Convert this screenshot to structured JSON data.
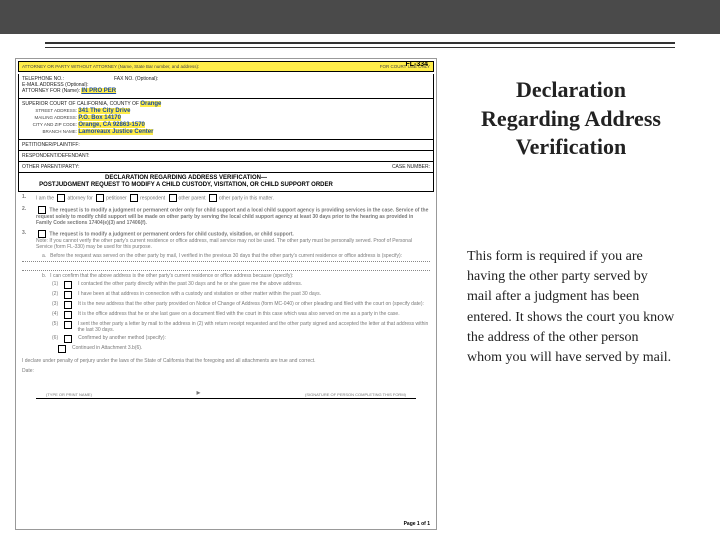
{
  "slide": {
    "title": "Declaration Regarding Address Verification",
    "description": "This form is required if you are having the other party served by mail after a judgment has been entered. It shows the court you know the address of the other person whom you will have served by mail."
  },
  "form": {
    "code": "FL-334",
    "attorney_header": "ATTORNEY OR PARTY WITHOUT ATTORNEY (Name, State Bar number, and address):",
    "court_use": "FOR COURT USE ONLY",
    "telephone": "TELEPHONE NO.:",
    "fax": "FAX NO. (Optional):",
    "email": "E-MAIL ADDRESS (Optional):",
    "atty_for": "ATTORNEY FOR (Name):",
    "in_pro_per": "IN PRO PER",
    "court_line": "SUPERIOR COURT OF CALIFORNIA, COUNTY OF",
    "county": "Orange",
    "street_lbl": "STREET ADDRESS:",
    "street": "341 The City Drive",
    "mail_lbl": "MAILING ADDRESS:",
    "mail": "P.O. Box 14170",
    "city_lbl": "CITY AND ZIP CODE:",
    "city": "Orange, CA 92863-1570",
    "branch_lbl": "BRANCH NAME:",
    "branch": "Lamoreaux Justice Center",
    "petitioner": "PETITIONER/PLAINTIFF:",
    "respondent": "RESPONDENT/DEFENDANT:",
    "other_party": "OTHER PARENT/PARTY:",
    "case_no": "CASE NUMBER:",
    "form_title_1": "DECLARATION REGARDING ADDRESS VERIFICATION—",
    "form_title_2": "POSTJUDGMENT REQUEST TO MODIFY A CHILD CUSTODY, VISITATION, OR CHILD SUPPORT ORDER",
    "item1": "I am the",
    "opt1": "attorney for",
    "opt2": "petitioner",
    "opt3": "respondent",
    "opt4": "other parent",
    "opt5": "other party",
    "item1_tail": "in this matter.",
    "item2": "The request is to modify a judgment or permanent order only for child support and a local child support agency is providing services in the case. Service of the request solely to modify child support will be made on other party by serving the local child support agency at least 30 days prior to the hearing as provided in Family Code sections 17404(e)(3) and 17406(f).",
    "item3": "The request is to modify a judgment or permanent orders for child custody, visitation, or child support.",
    "item3_note": "Note: If you cannot verify the other party's current residence or office address, mail service may not be used. The other party must be personally served. Proof of Personal Service (form FL-330) may be used for this purpose.",
    "item3a": "Before the request was served on the other party by mail, I verified in the previous 30 days that the other party's current residence or office address is (specify):",
    "item3b": "I can confirm that the above address is the other party's current residence or office address because (specify):",
    "sub1": "I contacted the other party directly within the past 30 days and he or she gave me the above address.",
    "sub2": "I have been at that address in connection with a custody and visitation or other matter within the past 30 days.",
    "sub3": "It is the new address that the other party provided on Notice of Change of Address (form MC-040) or other pleading and filed with the court on (specify date):",
    "sub4": "It is the office address that he or she last gave on a document filed with the court in this case which was also served on me as a party in the case.",
    "sub5": "I sent the other party a letter by mail to the address in (2) with return receipt requested and the other party signed and accepted the letter at that address within the last 30 days.",
    "sub6": "Confirmed by another method (specify):",
    "sub7": "Continued in Attachment 3.b(6).",
    "penalty": "I declare under penalty of perjury under the laws of the State of California that the foregoing and all attachments are true and correct.",
    "date": "Date:",
    "type_name": "(TYPE OR PRINT NAME)",
    "sig": "(SIGNATURE OF PERSON COMPLETING THIS FORM)",
    "page": "Page 1 of 1",
    "bottom_title": "DECLARATION REGARDING ADDRESS VERIFICATION"
  }
}
